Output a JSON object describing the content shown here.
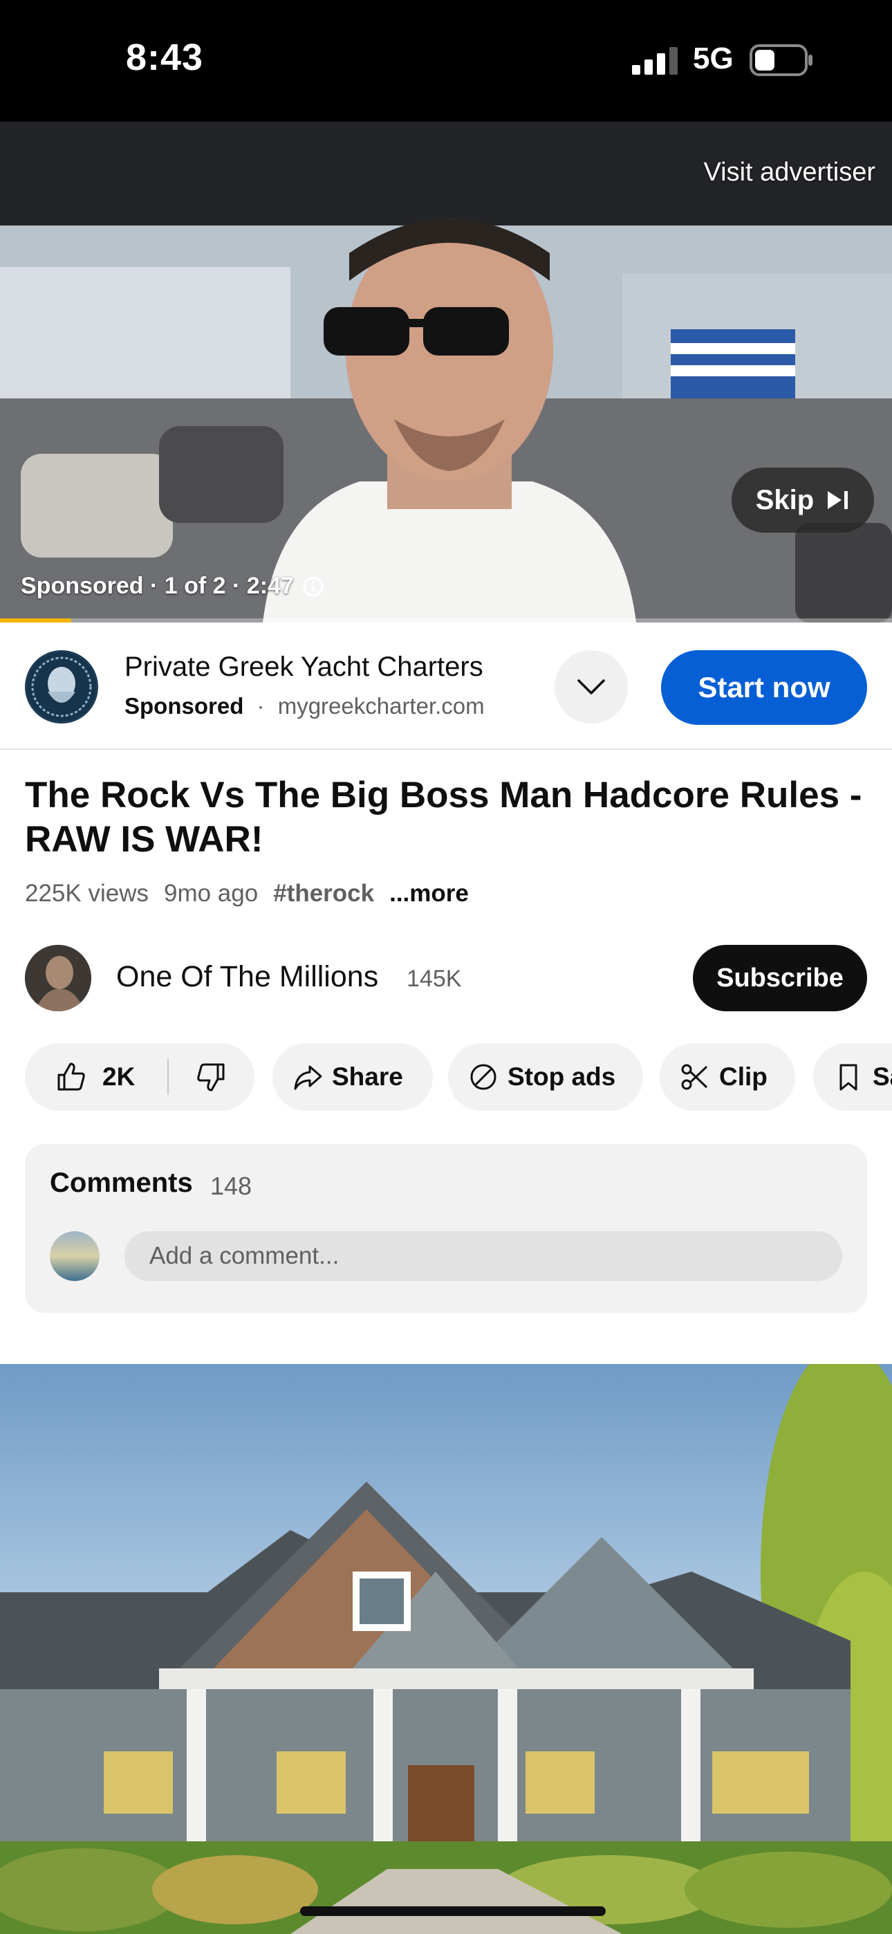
{
  "status_bar": {
    "time": "8:43",
    "network": "5G"
  },
  "video_ad": {
    "visit_label": "Visit advertiser",
    "skip_label": "Skip",
    "ad_info": "Sponsored · 1 of 2 · 2:47",
    "progress": 0.08
  },
  "advertiser": {
    "name": "Private Greek Yacht Charters",
    "sponsored_label": "Sponsored",
    "separator": "·",
    "domain": "mygreekcharter.com",
    "cta_label": "Start now"
  },
  "video": {
    "title": "The Rock Vs The Big Boss Man Hadcore Rules - RAW IS WAR!",
    "views": "225K views",
    "age": "9mo ago",
    "hashtag": "#therock",
    "more_label": "...more"
  },
  "channel": {
    "name": "One Of The Millions",
    "subscribers": "145K",
    "subscribe_label": "Subscribe"
  },
  "actions": {
    "likes": "2K",
    "share": "Share",
    "stop_ads": "Stop ads",
    "clip": "Clip",
    "save": "Sa"
  },
  "comments": {
    "heading": "Comments",
    "count": "148",
    "placeholder": "Add a comment..."
  },
  "colors": {
    "accent": "#065fd4",
    "progress": "#f2b400"
  }
}
